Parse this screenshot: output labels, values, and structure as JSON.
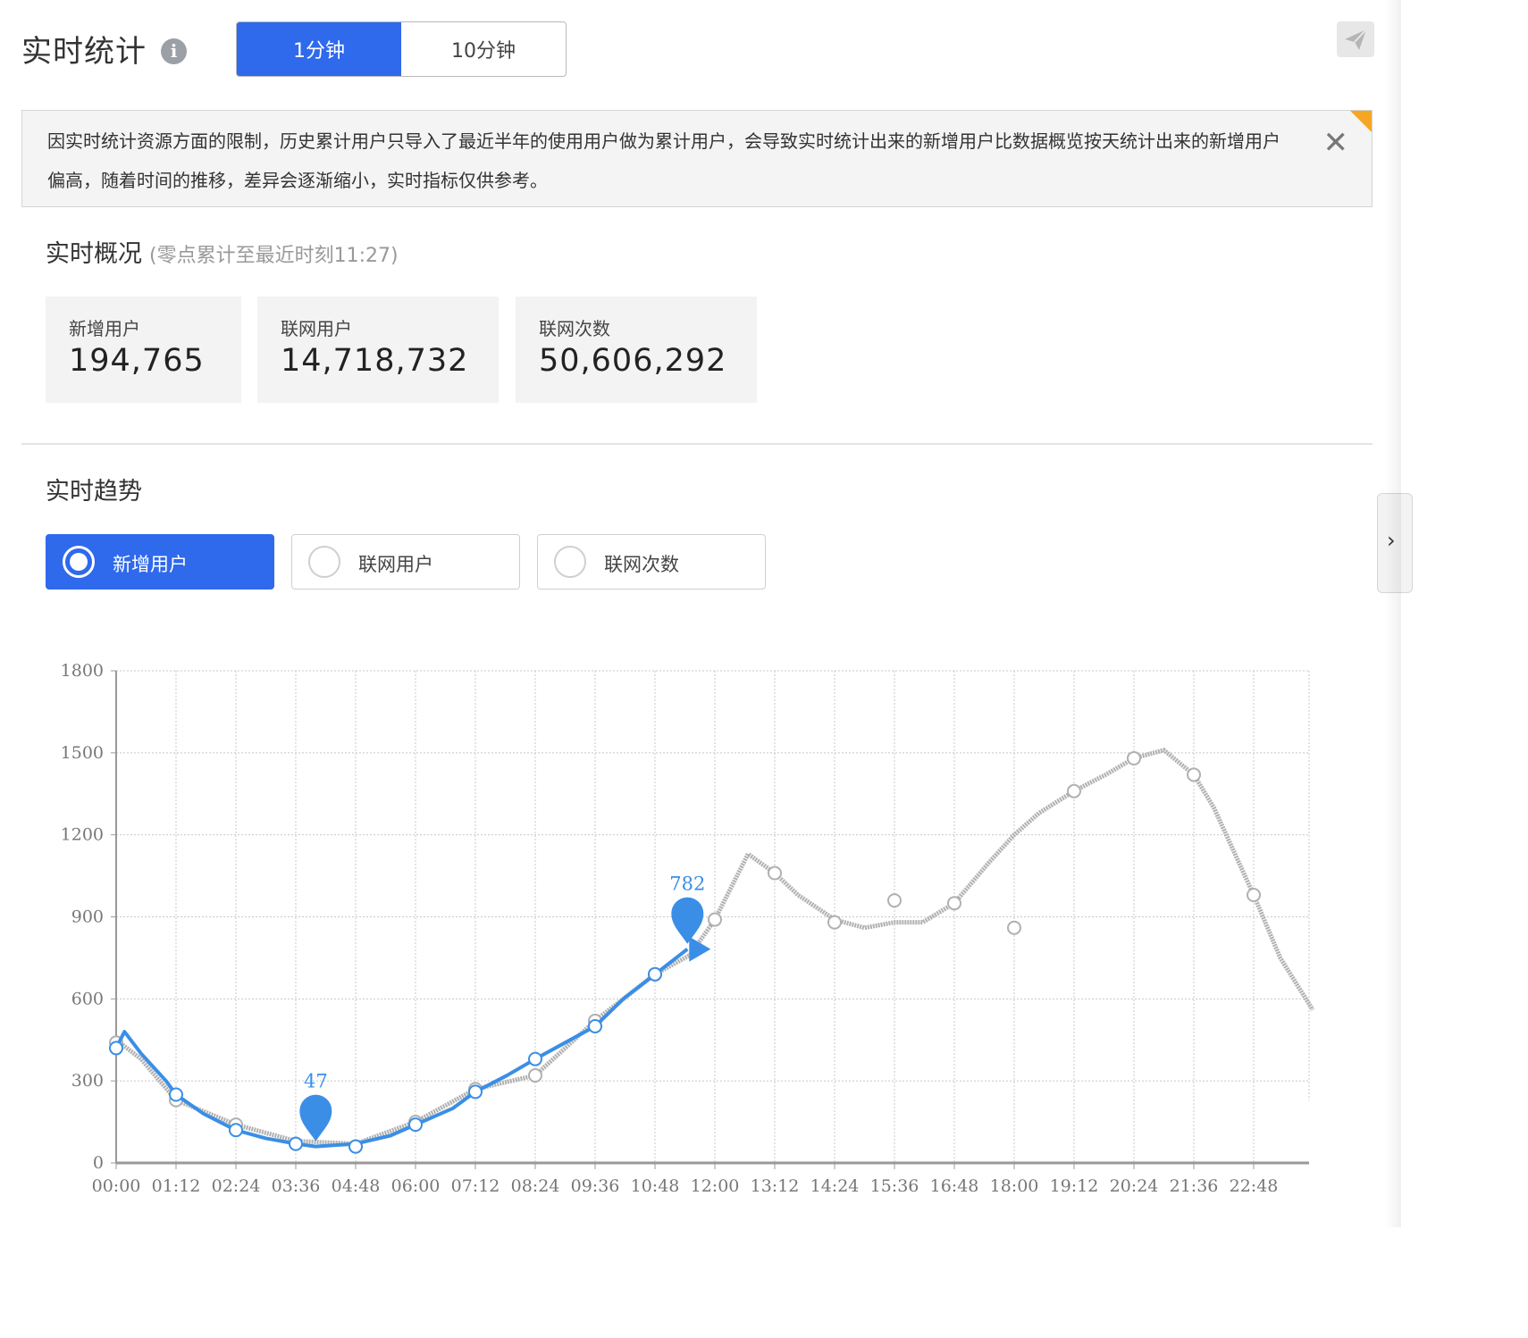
{
  "header": {
    "title": "实时统计",
    "info_icon": "info-icon",
    "tabs": [
      {
        "label": "1分钟",
        "active": true
      },
      {
        "label": "10分钟",
        "active": false
      }
    ],
    "share_icon": "send-icon"
  },
  "notice": {
    "text": "因实时统计资源方面的限制，历史累计用户只导入了最近半年的使用用户做为累计用户，会导致实时统计出来的新增用户比数据概览按天统计出来的新增用户偏高，随着时间的推移，差异会逐渐缩小，实时指标仅供参考。",
    "close_icon": "close-icon"
  },
  "overview": {
    "title": "实时概况",
    "subtitle": "(零点累计至最近时刻11:27)",
    "cards": [
      {
        "label": "新增用户",
        "value": "194,765"
      },
      {
        "label": "联网用户",
        "value": "14,718,732"
      },
      {
        "label": "联网次数",
        "value": "50,606,292"
      }
    ]
  },
  "trend": {
    "title": "实时趋势",
    "metrics": [
      {
        "label": "新增用户",
        "selected": true
      },
      {
        "label": "联网用户",
        "selected": false
      },
      {
        "label": "联网次数",
        "selected": false
      }
    ]
  },
  "colors": {
    "accent": "#2f69ec",
    "today_series": "#3a8ee6",
    "compare_series": "#b0b0b0"
  },
  "chart_data": {
    "type": "line",
    "title": "",
    "xlabel": "",
    "ylabel": "",
    "ylim": [
      0,
      1800
    ],
    "yticks": [
      0,
      300,
      600,
      900,
      1200,
      1500,
      1800
    ],
    "xticks": [
      "00:00",
      "01:12",
      "02:24",
      "03:36",
      "04:48",
      "06:00",
      "07:12",
      "08:24",
      "09:36",
      "10:48",
      "12:00",
      "13:12",
      "14:24",
      "15:36",
      "16:48",
      "18:00",
      "19:12",
      "20:24",
      "21:36",
      "22:48"
    ],
    "grid": true,
    "series": [
      {
        "style": "blue",
        "x": [
          "00:00",
          "00:10",
          "00:30",
          "01:00",
          "01:12",
          "01:45",
          "02:24",
          "03:00",
          "03:36",
          "04:00",
          "04:48",
          "05:30",
          "06:00",
          "06:45",
          "07:12",
          "07:50",
          "08:24",
          "09:00",
          "09:36",
          "10:10",
          "10:48",
          "11:27"
        ],
        "values": [
          420,
          480,
          400,
          300,
          250,
          180,
          120,
          90,
          70,
          60,
          70,
          100,
          140,
          200,
          260,
          320,
          380,
          440,
          500,
          600,
          690,
          782
        ],
        "markers_x": [
          "00:00",
          "01:12",
          "02:24",
          "03:36",
          "04:48",
          "06:00",
          "07:12",
          "08:24",
          "09:36",
          "10:48"
        ],
        "markers": [
          420,
          250,
          120,
          70,
          60,
          140,
          260,
          380,
          500,
          690
        ],
        "pins": [
          {
            "x": "04:00",
            "label": "47"
          },
          {
            "x": "11:27",
            "label": "782"
          }
        ]
      },
      {
        "style": "gray",
        "x": [
          "00:00",
          "00:30",
          "01:12",
          "02:24",
          "03:36",
          "04:48",
          "06:00",
          "07:12",
          "08:24",
          "09:36",
          "10:48",
          "11:30",
          "12:00",
          "12:40",
          "13:12",
          "13:40",
          "14:24",
          "15:00",
          "15:36",
          "16:10",
          "16:48",
          "17:30",
          "18:00",
          "18:30",
          "19:12",
          "19:50",
          "20:24",
          "21:00",
          "21:36",
          "22:00",
          "22:48",
          "23:20",
          "23:59"
        ],
        "values": [
          450,
          380,
          230,
          140,
          80,
          70,
          150,
          270,
          320,
          520,
          690,
          760,
          890,
          1130,
          1060,
          980,
          890,
          860,
          880,
          880,
          950,
          1100,
          1200,
          1280,
          1360,
          1420,
          1480,
          1510,
          1420,
          1300,
          980,
          750,
          560
        ],
        "markers_x": [
          "00:00",
          "01:12",
          "02:24",
          "03:36",
          "04:48",
          "06:00",
          "07:12",
          "08:24",
          "09:36",
          "10:48",
          "12:00",
          "13:12",
          "14:24",
          "15:36",
          "16:48",
          "18:00",
          "19:12",
          "20:24",
          "21:36",
          "22:48"
        ],
        "markers": [
          440,
          230,
          140,
          70,
          60,
          150,
          270,
          320,
          520,
          690,
          890,
          1060,
          880,
          960,
          950,
          860,
          1360,
          1480,
          1420,
          980
        ]
      }
    ]
  }
}
